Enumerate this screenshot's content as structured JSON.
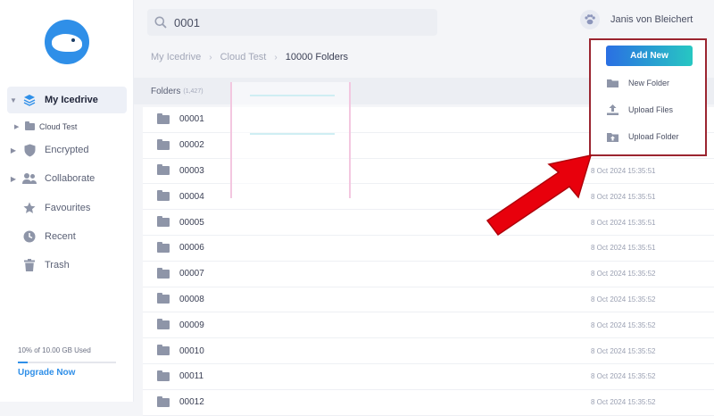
{
  "sidebar": {
    "items": [
      {
        "label": "My Icedrive",
        "icon": "layers-icon",
        "active": true,
        "expandable": true
      },
      {
        "label": "Encrypted",
        "icon": "shield-icon",
        "expandable": true
      },
      {
        "label": "Collaborate",
        "icon": "users-icon",
        "expandable": true
      },
      {
        "label": "Favourites",
        "icon": "star-icon",
        "expandable": false
      },
      {
        "label": "Recent",
        "icon": "clock-icon",
        "expandable": false
      },
      {
        "label": "Trash",
        "icon": "trash-icon",
        "expandable": false
      }
    ],
    "subitem": {
      "label": "Cloud Test",
      "icon": "folder-icon"
    },
    "storage_text": "10% of 10.00 GB Used",
    "storage_fraction": 0.1,
    "upgrade_label": "Upgrade Now"
  },
  "search": {
    "value": "0001",
    "icon": "search-icon"
  },
  "user": {
    "name": "Janis von Bleichert",
    "avatar_icon": "paw-icon"
  },
  "breadcrumb": [
    "My Icedrive",
    "Cloud Test",
    "10000 Folders"
  ],
  "list": {
    "header": "Folders",
    "count": "(1,427)",
    "rows": [
      {
        "name": "00001",
        "date": ""
      },
      {
        "name": "00002",
        "date": ""
      },
      {
        "name": "00003",
        "date": "8 Oct 2024 15:35:51"
      },
      {
        "name": "00004",
        "date": "8 Oct 2024 15:35:51"
      },
      {
        "name": "00005",
        "date": "8 Oct 2024 15:35:51"
      },
      {
        "name": "00006",
        "date": "8 Oct 2024 15:35:51"
      },
      {
        "name": "00007",
        "date": "8 Oct 2024 15:35:52"
      },
      {
        "name": "00008",
        "date": "8 Oct 2024 15:35:52"
      },
      {
        "name": "00009",
        "date": "8 Oct 2024 15:35:52"
      },
      {
        "name": "00010",
        "date": "8 Oct 2024 15:35:52"
      },
      {
        "name": "00011",
        "date": "8 Oct 2024 15:35:52"
      },
      {
        "name": "00012",
        "date": "8 Oct 2024 15:35:52"
      }
    ]
  },
  "add_new": {
    "label": "Add New",
    "menu": [
      {
        "label": "New Folder",
        "icon": "folder-icon"
      },
      {
        "label": "Upload Files",
        "icon": "upload-icon"
      },
      {
        "label": "Upload Folder",
        "icon": "folder-upload-icon"
      }
    ]
  },
  "colors": {
    "accent": "#2f8fe8",
    "highlight_box": "#9b2530",
    "arrow": "#e8000c"
  }
}
